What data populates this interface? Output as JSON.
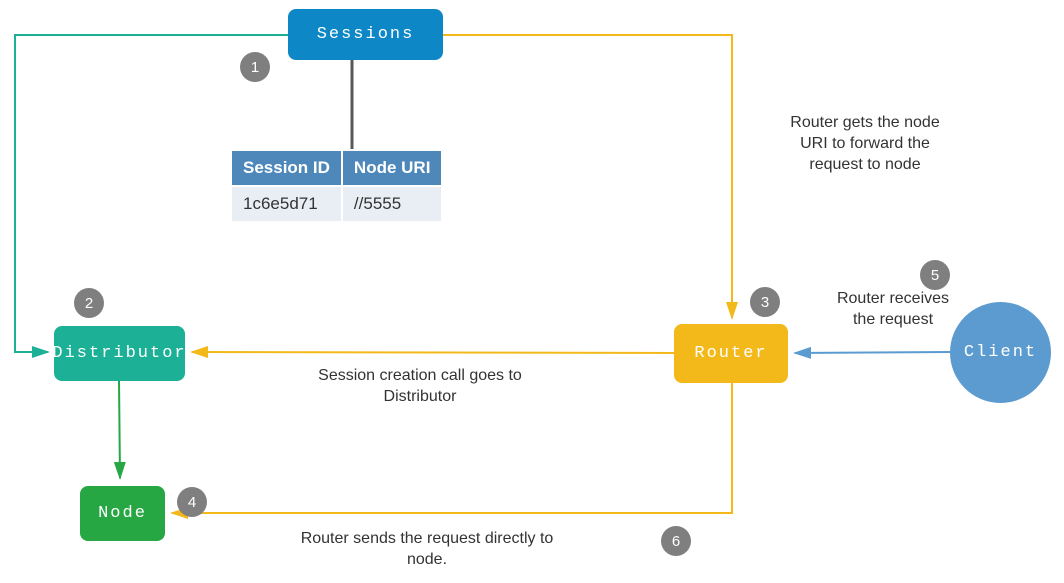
{
  "nodes": {
    "sessions": {
      "label": "Sessions",
      "badge": "1"
    },
    "distributor": {
      "label": "Distributor",
      "badge": "2"
    },
    "router": {
      "label": "Router",
      "badge": "3"
    },
    "node": {
      "label": "Node",
      "badge": "4"
    },
    "client": {
      "label": "Client",
      "badge": "5"
    },
    "router_to_node_badge": "6"
  },
  "table": {
    "headers": {
      "col1": "Session ID",
      "col2": "Node URI"
    },
    "row": {
      "col1": "1c6e5d71",
      "col2": "//5555"
    }
  },
  "annotations": {
    "router_uri": "Router gets the node URI to forward the request to node",
    "router_receives": "Router receives the request",
    "session_creation": "Session creation call goes to Distributor",
    "router_sends": "Router sends the request directly to node."
  },
  "colors": {
    "sessions": "#0e87c7",
    "distributor": "#1cb196",
    "router": "#f3b91a",
    "node": "#27a744",
    "client": "#5c9bd0",
    "badge": "#7f7f7f",
    "table_header": "#4e88ba",
    "table_row": "#e8eef4",
    "arrow_teal": "#1cb196",
    "arrow_yellow": "#f3b91a",
    "arrow_green": "#27a744",
    "arrow_blue": "#5c9bd0",
    "dark_line": "#595959"
  }
}
